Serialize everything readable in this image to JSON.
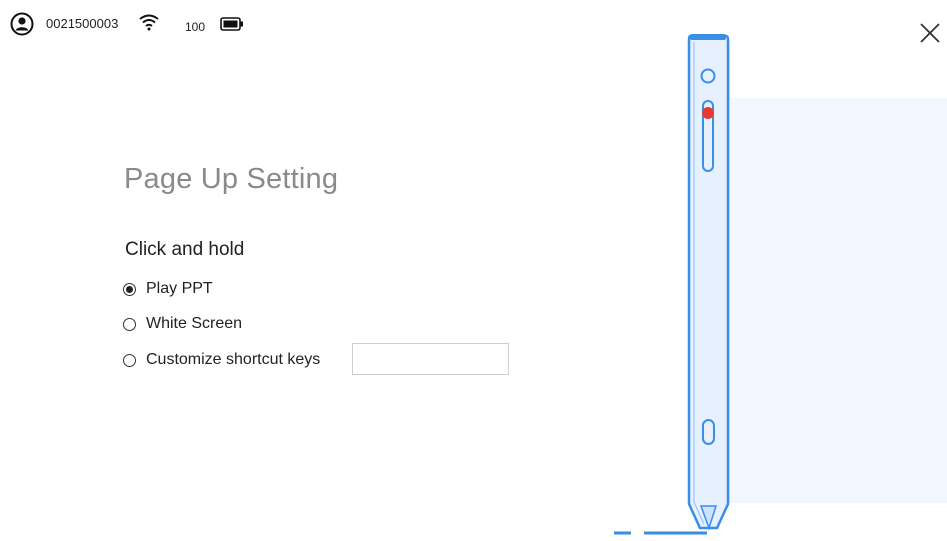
{
  "status": {
    "device_id": "0021500003",
    "battery_level": "100",
    "icons": {
      "user": "user-icon",
      "wifi": "wifi-icon",
      "battery": "battery-icon"
    }
  },
  "window": {
    "close_icon": "close-icon"
  },
  "page_title": "Page Up Setting",
  "section_label": "Click and hold",
  "options": [
    {
      "label": "Play PPT",
      "selected": true
    },
    {
      "label": "White Screen",
      "selected": false
    },
    {
      "label": "Customize shortcut keys",
      "selected": false
    }
  ],
  "shortcut_input": {
    "value": ""
  },
  "colors": {
    "title": "#8a8a8a",
    "pen_stroke": "#3a8ee6",
    "pen_fill": "#e6f0ff",
    "panel_bg": "#f0f7ff",
    "indicator": "#e53935"
  }
}
